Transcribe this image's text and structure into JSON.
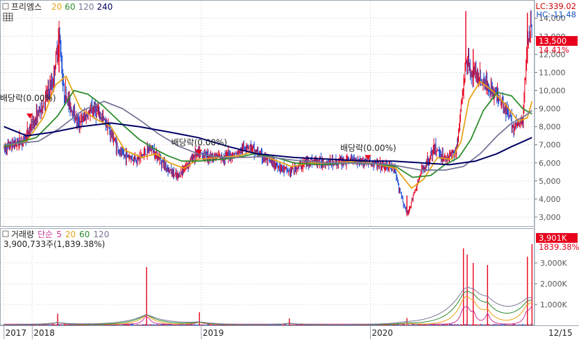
{
  "price_panel": {
    "menu_icon": "square-menu-icon",
    "name": "프리엠스",
    "ma_labels": [
      {
        "text": "20",
        "color": "#e8a317"
      },
      {
        "text": "60",
        "color": "#2e8b2e"
      },
      {
        "text": "120",
        "color": "#777799"
      },
      {
        "text": "240",
        "color": "#000066"
      }
    ],
    "grid_icon": "grid-table-icon",
    "lc_label": "LC:339.02",
    "hc_label": "HC:-11.48",
    "current_price": "13,500",
    "change_pct": "14.41%",
    "annotations": [
      "배당락(0.00%)",
      "배당락(0.00%)",
      "배당락(0.00%)"
    ]
  },
  "volume_panel": {
    "menu_icon": "square-menu-icon",
    "title": "거래량",
    "ma_type": "단순",
    "ma_labels": [
      {
        "text": "5",
        "color": "#cc3399"
      },
      {
        "text": "20",
        "color": "#e8a317"
      },
      {
        "text": "60",
        "color": "#2e8b2e"
      },
      {
        "text": "120",
        "color": "#777799"
      }
    ],
    "summary": "3,900,733주(1,839.38%)",
    "current_volume": "3,901K",
    "current_pct": "1839.38%"
  },
  "time_axis": {
    "labels": [
      "2017",
      "2018",
      "2019",
      "2020"
    ],
    "right_label": "12/15"
  },
  "colors": {
    "up": "#e8001c",
    "down": "#1e4fd6",
    "ma20": "#e8a317",
    "ma60": "#2e8b2e",
    "ma120": "#777799",
    "ma240": "#000066",
    "ma5": "#cc3399",
    "highlight": "#e8001c",
    "grid": "#c8c8c8",
    "axis_text": "#555555"
  },
  "chart_data": [
    {
      "type": "line",
      "title": "프리엠스",
      "x_range": [
        "2017-11",
        "2020-12-15"
      ],
      "ylim": [
        2500,
        14700
      ],
      "y_ticks": [
        3000,
        4000,
        5000,
        6000,
        7000,
        8000,
        9000,
        10000,
        11000,
        12000,
        13000,
        14000
      ],
      "y_tick_labels": [
        "3,000",
        "4,000",
        "5,000",
        "6,000",
        "7,000",
        "8,000",
        "9,000",
        "10,000",
        "11,000",
        "12,000",
        "13,000",
        "14,000"
      ],
      "grid": true,
      "current_value": 13500,
      "price_points": [
        [
          "2017-11-01",
          6800
        ],
        [
          "2017-12-15",
          7300
        ],
        [
          "2018-01-20",
          9000
        ],
        [
          "2018-02-15",
          10500
        ],
        [
          "2018-02-28",
          13200
        ],
        [
          "2018-03-10",
          10000
        ],
        [
          "2018-04-10",
          8200
        ],
        [
          "2018-05-15",
          9000
        ],
        [
          "2018-06-10",
          8200
        ],
        [
          "2018-07-10",
          6500
        ],
        [
          "2018-08-15",
          6200
        ],
        [
          "2018-09-15",
          6800
        ],
        [
          "2018-10-20",
          5700
        ],
        [
          "2018-11-10",
          5200
        ],
        [
          "2018-12-20",
          6500
        ],
        [
          "2019-02-10",
          6300
        ],
        [
          "2019-03-20",
          6500
        ],
        [
          "2019-04-10",
          7000
        ],
        [
          "2019-05-20",
          6200
        ],
        [
          "2019-07-10",
          5500
        ],
        [
          "2019-08-20",
          6100
        ],
        [
          "2019-10-10",
          6000
        ],
        [
          "2019-12-01",
          6200
        ],
        [
          "2020-01-15",
          5900
        ],
        [
          "2020-02-20",
          5700
        ],
        [
          "2020-03-20",
          3100
        ],
        [
          "2020-04-20",
          5500
        ],
        [
          "2020-05-20",
          6800
        ],
        [
          "2020-06-10",
          6200
        ],
        [
          "2020-07-05",
          6700
        ],
        [
          "2020-07-25",
          11500
        ],
        [
          "2020-08-10",
          11000
        ],
        [
          "2020-09-01",
          10500
        ],
        [
          "2020-10-10",
          9500
        ],
        [
          "2020-11-05",
          8000
        ],
        [
          "2020-11-25",
          8300
        ],
        [
          "2020-12-05",
          13000
        ],
        [
          "2020-12-15",
          13500
        ]
      ],
      "series": [
        {
          "name": "20",
          "color": "#e8a317",
          "points": [
            [
              "2017-11-01",
              6900
            ],
            [
              "2017-12-20",
              7200
            ],
            [
              "2018-01-25",
              8500
            ],
            [
              "2018-02-20",
              10300
            ],
            [
              "2018-03-15",
              10800
            ],
            [
              "2018-04-15",
              9000
            ],
            [
              "2018-05-20",
              8400
            ],
            [
              "2018-06-20",
              8000
            ],
            [
              "2018-07-20",
              6700
            ],
            [
              "2018-08-25",
              6300
            ],
            [
              "2018-09-25",
              6500
            ],
            [
              "2018-10-25",
              6000
            ],
            [
              "2018-11-25",
              5700
            ],
            [
              "2018-12-25",
              6200
            ],
            [
              "2019-02-10",
              6300
            ],
            [
              "2019-03-25",
              6400
            ],
            [
              "2019-04-20",
              6600
            ],
            [
              "2019-05-25",
              6300
            ],
            [
              "2019-07-15",
              5800
            ],
            [
              "2019-08-25",
              6000
            ],
            [
              "2019-10-15",
              6000
            ],
            [
              "2019-12-10",
              6100
            ],
            [
              "2020-01-20",
              5900
            ],
            [
              "2020-02-25",
              5700
            ],
            [
              "2020-03-30",
              4600
            ],
            [
              "2020-04-25",
              5100
            ],
            [
              "2020-05-25",
              6300
            ],
            [
              "2020-06-25",
              6200
            ],
            [
              "2020-07-15",
              7200
            ],
            [
              "2020-08-01",
              9500
            ],
            [
              "2020-08-25",
              10500
            ],
            [
              "2020-09-20",
              10000
            ],
            [
              "2020-10-20",
              9200
            ],
            [
              "2020-11-15",
              8300
            ],
            [
              "2020-12-05",
              8500
            ],
            [
              "2020-12-15",
              9400
            ]
          ]
        },
        {
          "name": "60",
          "color": "#2e8b2e",
          "points": [
            [
              "2017-11-01",
              6900
            ],
            [
              "2018-01-10",
              7400
            ],
            [
              "2018-02-25",
              8600
            ],
            [
              "2018-04-01",
              10000
            ],
            [
              "2018-05-01",
              9800
            ],
            [
              "2018-06-01",
              9200
            ],
            [
              "2018-07-20",
              8000
            ],
            [
              "2018-08-20",
              7300
            ],
            [
              "2018-09-20",
              6800
            ],
            [
              "2018-10-20",
              6400
            ],
            [
              "2018-11-20",
              6100
            ],
            [
              "2018-12-25",
              6100
            ],
            [
              "2019-02-15",
              6200
            ],
            [
              "2019-03-20",
              6300
            ],
            [
              "2019-04-25",
              6500
            ],
            [
              "2019-06-10",
              6300
            ],
            [
              "2019-07-20",
              6000
            ],
            [
              "2019-09-15",
              5900
            ],
            [
              "2019-11-15",
              6000
            ],
            [
              "2020-01-10",
              5950
            ],
            [
              "2020-02-25",
              5800
            ],
            [
              "2020-04-01",
              5200
            ],
            [
              "2020-05-10",
              5300
            ],
            [
              "2020-06-10",
              5900
            ],
            [
              "2020-07-10",
              6300
            ],
            [
              "2020-08-05",
              7300
            ],
            [
              "2020-09-01",
              8900
            ],
            [
              "2020-10-01",
              9900
            ],
            [
              "2020-11-01",
              9700
            ],
            [
              "2020-11-25",
              9000
            ],
            [
              "2020-12-15",
              8700
            ]
          ]
        },
        {
          "name": "120",
          "color": "#777799",
          "points": [
            [
              "2017-11-01",
              7000
            ],
            [
              "2018-01-15",
              7200
            ],
            [
              "2018-03-01",
              7900
            ],
            [
              "2018-04-20",
              8900
            ],
            [
              "2018-06-05",
              9400
            ],
            [
              "2018-07-15",
              9000
            ],
            [
              "2018-08-25",
              8300
            ],
            [
              "2018-10-01",
              7600
            ],
            [
              "2018-11-15",
              6900
            ],
            [
              "2018-12-25",
              6500
            ],
            [
              "2019-02-15",
              6300
            ],
            [
              "2019-04-01",
              6300
            ],
            [
              "2019-05-20",
              6350
            ],
            [
              "2019-07-20",
              6150
            ],
            [
              "2019-09-30",
              6000
            ],
            [
              "2019-12-10",
              6000
            ],
            [
              "2020-02-15",
              5900
            ],
            [
              "2020-04-20",
              5600
            ],
            [
              "2020-06-10",
              5600
            ],
            [
              "2020-07-20",
              5800
            ],
            [
              "2020-08-25",
              6500
            ],
            [
              "2020-10-01",
              7500
            ],
            [
              "2020-11-01",
              8200
            ],
            [
              "2020-11-30",
              8600
            ],
            [
              "2020-12-15",
              8900
            ]
          ]
        },
        {
          "name": "240",
          "color": "#000066",
          "points": [
            [
              "2017-11-01",
              8000
            ],
            [
              "2017-12-20",
              7500
            ],
            [
              "2018-02-15",
              7700
            ],
            [
              "2018-04-15",
              8000
            ],
            [
              "2018-06-20",
              8200
            ],
            [
              "2018-08-20",
              8000
            ],
            [
              "2018-10-25",
              7700
            ],
            [
              "2018-12-25",
              7400
            ],
            [
              "2019-03-01",
              6900
            ],
            [
              "2019-05-01",
              6500
            ],
            [
              "2019-07-20",
              6300
            ],
            [
              "2019-10-10",
              6200
            ],
            [
              "2019-12-20",
              6100
            ],
            [
              "2020-02-20",
              6100
            ],
            [
              "2020-04-20",
              6000
            ],
            [
              "2020-06-20",
              5900
            ],
            [
              "2020-08-15",
              6100
            ],
            [
              "2020-09-30",
              6500
            ],
            [
              "2020-11-01",
              6900
            ],
            [
              "2020-12-15",
              7400
            ]
          ]
        }
      ],
      "dividend_markers": [
        {
          "date": "2017-12-27",
          "value": 8500
        },
        {
          "date": "2018-12-27",
          "value": 6500
        },
        {
          "date": "2019-12-27",
          "value": 6200
        }
      ]
    },
    {
      "type": "bar",
      "title": "거래량",
      "x_range": [
        "2017-11",
        "2020-12-15"
      ],
      "ylim": [
        0,
        4200
      ],
      "y_unit": "K",
      "y_ticks": [
        1000,
        2000,
        3000
      ],
      "y_tick_labels": [
        "1,000K",
        "2,000K",
        "3,000K"
      ],
      "grid": true,
      "current_value": 3901,
      "volume_spikes": [
        {
          "date": "2018-02-25",
          "value": 560
        },
        {
          "date": "2018-09-05",
          "value": 2800
        },
        {
          "date": "2018-12-28",
          "value": 630
        },
        {
          "date": "2019-07-10",
          "value": 330
        },
        {
          "date": "2020-03-20",
          "value": 350
        },
        {
          "date": "2020-07-20",
          "value": 3700
        },
        {
          "date": "2020-07-28",
          "value": 3400
        },
        {
          "date": "2020-08-10",
          "value": 3000
        },
        {
          "date": "2020-09-10",
          "value": 2900
        },
        {
          "date": "2020-12-05",
          "value": 3300
        },
        {
          "date": "2020-12-15",
          "value": 3901
        }
      ]
    }
  ]
}
